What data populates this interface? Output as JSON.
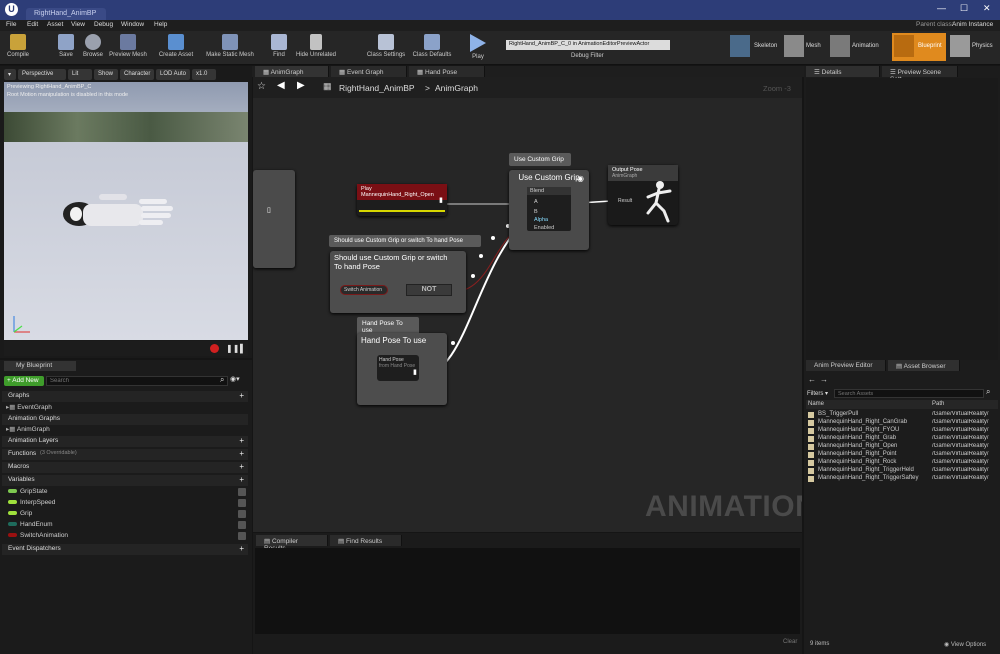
{
  "window": {
    "tab_title": "RightHand_AnimBP",
    "parent_class_label": "Parent class:",
    "parent_class": "Anim Instance"
  },
  "menu": [
    "File",
    "Edit",
    "Asset",
    "View",
    "Debug",
    "Window",
    "Help"
  ],
  "toolbar": {
    "compile": "Compile",
    "save": "Save",
    "browse": "Browse",
    "preview_mesh": "Preview Mesh",
    "create_asset": "Create Asset",
    "make_static_mesh": "Make Static Mesh",
    "find": "Find",
    "hide_unrelated": "Hide Unrelated",
    "class_settings": "Class Settings",
    "class_defaults": "Class Defaults",
    "play": "Play",
    "debug_target": "RightHand_AnimBP_C_0 in AnimationEditorPreviewActor",
    "debug_filter": "Debug Filter"
  },
  "modes": {
    "skeleton": "Skeleton",
    "mesh": "Mesh",
    "animation": "Animation",
    "blueprint": "Blueprint",
    "physics": "Physics"
  },
  "viewport": {
    "perspective": "Perspective",
    "lit": "Lit",
    "show": "Show",
    "character": "Character",
    "lod": "LOD Auto",
    "speed": "x1.0",
    "info_line1": "Previewing RightHand_AnimBP_C",
    "info_line2": "Root Motion manipulation is disabled in this mode"
  },
  "my_blueprint": {
    "tab": "My Blueprint",
    "add_new": "+ Add New",
    "search_placeholder": "Search",
    "graphs": "Graphs",
    "event_graph": "EventGraph",
    "animation_graphs": "Animation Graphs",
    "anim_graph": "AnimGraph",
    "animation_layers": "Animation Layers",
    "functions": "Functions",
    "functions_count": "(3 Overridable)",
    "macros": "Macros",
    "variables": "Variables",
    "event_dispatchers": "Event Dispatchers",
    "vars": [
      {
        "name": "GripState",
        "color": "#7ec850"
      },
      {
        "name": "InterpSpeed",
        "color": "#9fe03c"
      },
      {
        "name": "Grip",
        "color": "#9fe03c"
      },
      {
        "name": "HandEnum",
        "color": "#1e6b5c"
      },
      {
        "name": "SwitchAnimation",
        "color": "#9a1010"
      }
    ]
  },
  "graph_tabs": [
    "AnimGraph",
    "Event Graph",
    "Hand Pose"
  ],
  "breadcrumb": {
    "bp": "RightHand_AnimBP",
    "sep": ">",
    "graph": "AnimGraph",
    "zoom": "Zoom -3"
  },
  "nodes": {
    "play_node": "Play MannequinHand_Right_Open",
    "comment_grip": "Use Custom Grip",
    "blend_title": "Use Custom Grip",
    "blend_sub": "Blend",
    "pin_a": "A",
    "pin_b": "B",
    "pin_alpha": "Alpha",
    "pin_enabled": "Enabled",
    "output_pose": "Output Pose",
    "output_sub": "AnimGraph",
    "result": "Result",
    "comment_switch": "Should use Custom Grip or switch To hand Pose",
    "switch_title": "Should use Custom Grip or switch To hand Pose",
    "switch_var": "Switch Animation",
    "not": "NOT",
    "comment_pose": "Hand Pose To use",
    "pose_title": "Hand Pose To use",
    "hand_pose": "Hand Pose",
    "hand_pose_sub": "from Hand Pose"
  },
  "watermark": "ANIMATION",
  "results": {
    "compiler": "Compiler Results",
    "find": "Find Results",
    "clear": "Clear"
  },
  "right": {
    "details": "Details",
    "preview_scene": "Preview Scene Sett",
    "anim_preview": "Anim Preview Editor",
    "asset_browser": "Asset Browser",
    "filters": "Filters",
    "search_assets": "Search Assets",
    "col_name": "Name",
    "col_path": "Path",
    "items": [
      {
        "name": "BS_TriggerPull",
        "path": "/Game/VirtualReality/"
      },
      {
        "name": "MannequinHand_Right_CanGrab",
        "path": "/Game/VirtualReality/"
      },
      {
        "name": "MannequinHand_Right_FYOU",
        "path": "/Game/VirtualReality/"
      },
      {
        "name": "MannequinHand_Right_Grab",
        "path": "/Game/VirtualReality/"
      },
      {
        "name": "MannequinHand_Right_Open",
        "path": "/Game/VirtualReality/"
      },
      {
        "name": "MannequinHand_Right_Point",
        "path": "/Game/VirtualReality/"
      },
      {
        "name": "MannequinHand_Right_Rock",
        "path": "/Game/VirtualReality/"
      },
      {
        "name": "MannequinHand_Right_TriggerHeld",
        "path": "/Game/VirtualReality/"
      },
      {
        "name": "MannequinHand_Right_TriggerSaftey",
        "path": "/Game/VirtualReality/"
      }
    ],
    "count": "9 items",
    "view_options": "View Options"
  }
}
